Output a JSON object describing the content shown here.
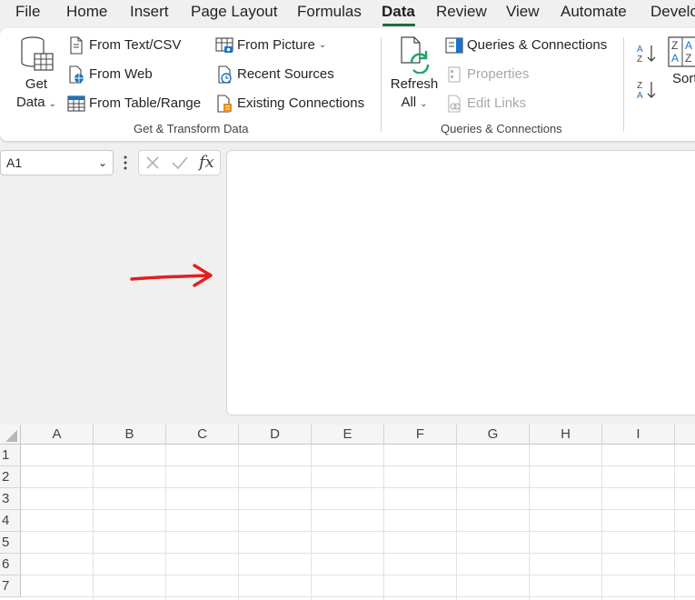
{
  "menu": {
    "tabs": [
      {
        "label": "File"
      },
      {
        "label": "Home"
      },
      {
        "label": "Insert"
      },
      {
        "label": "Page Layout"
      },
      {
        "label": "Formulas"
      },
      {
        "label": "Data",
        "active": true
      },
      {
        "label": "Review"
      },
      {
        "label": "View"
      },
      {
        "label": "Automate"
      },
      {
        "label": "Develo"
      }
    ]
  },
  "ribbon": {
    "get_transform": {
      "get_data": {
        "line1": "Get",
        "line2": "Data"
      },
      "from_text_csv": "From Text/CSV",
      "from_web": "From Web",
      "from_table_range": "From Table/Range",
      "from_picture": "From Picture",
      "recent_sources": "Recent Sources",
      "existing_connections": "Existing Connections",
      "group_label": "Get & Transform Data"
    },
    "queries": {
      "refresh_all": {
        "line1": "Refresh",
        "line2": "All"
      },
      "queries_connections": "Queries & Connections",
      "properties": "Properties",
      "edit_links": "Edit Links",
      "group_label": "Queries & Connections"
    },
    "sort_filter": {
      "sort": "Sort"
    }
  },
  "formula_bar": {
    "name_box": "A1",
    "fx": "fx",
    "formula": ""
  },
  "sheet": {
    "columns": [
      "A",
      "B",
      "C",
      "D",
      "E",
      "F",
      "G",
      "H",
      "I"
    ],
    "rows": [
      "1",
      "2",
      "3",
      "4",
      "5",
      "6",
      "7"
    ]
  },
  "annotation": {
    "color": "#e02020"
  },
  "colors": {
    "accent": "#1e6b3c",
    "excel_green": "#21a366",
    "link_blue": "#1a73c7"
  }
}
